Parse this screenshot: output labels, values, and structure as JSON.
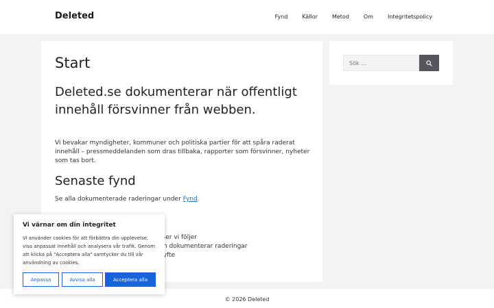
{
  "header": {
    "brand": "Deleted",
    "nav": [
      "Fynd",
      "Källor",
      "Metod",
      "Om",
      "Integritetspolicy"
    ]
  },
  "main": {
    "title": "Start",
    "intro_heading": "Deleted.se dokumenterar när offentligt innehåll försvinner från webben.",
    "intro_text": "Vi bevakar myndigheter, kommuner och politiska partier för att spåra raderat innehåll – pressmeddelanden som dras tillbaka, rapporter som försvinner, nyheter som tas bort.",
    "section_heading": "Senaste fynd",
    "section_text_prefix": "Se alla dokumenterade raderingar under ",
    "section_link": "Fynd",
    "section_text_suffix": ".",
    "list_fragments": [
      "tser vi följer",
      "ch dokumenterar raderingar",
      "syfte"
    ]
  },
  "sidebar": {
    "search_placeholder": "Sök …",
    "search_icon": "search-icon"
  },
  "footer": {
    "copyright": "© 2026 Deleted"
  },
  "cookie": {
    "title": "Vi värnar om din integritet",
    "text": "Vi använder cookies för att förbättra din upplevelse, visa anpassat innehåll och analysera vår trafik. Genom att klicka på \"Acceptera alla\" samtycker du till vår användning av cookies.",
    "customize_label": "Anpassa",
    "reject_label": "Avvisa alla",
    "accept_label": "Acceptera alla",
    "accent_color": "#1863dc"
  }
}
